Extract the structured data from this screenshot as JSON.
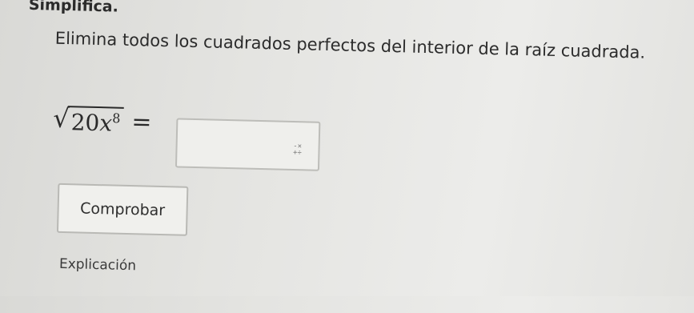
{
  "header": {
    "title": "Simplifica."
  },
  "problem": {
    "instruction": "Elimina todos los cuadrados perfectos del interior de la raíz cuadrada.",
    "radicand_number": "20",
    "radicand_variable": "x",
    "exponent": "8",
    "equals": "="
  },
  "answer": {
    "value": "",
    "keypad_icon": "math-keypad-icon"
  },
  "actions": {
    "check_label": "Comprobar",
    "explanation_label": "Explicación"
  }
}
